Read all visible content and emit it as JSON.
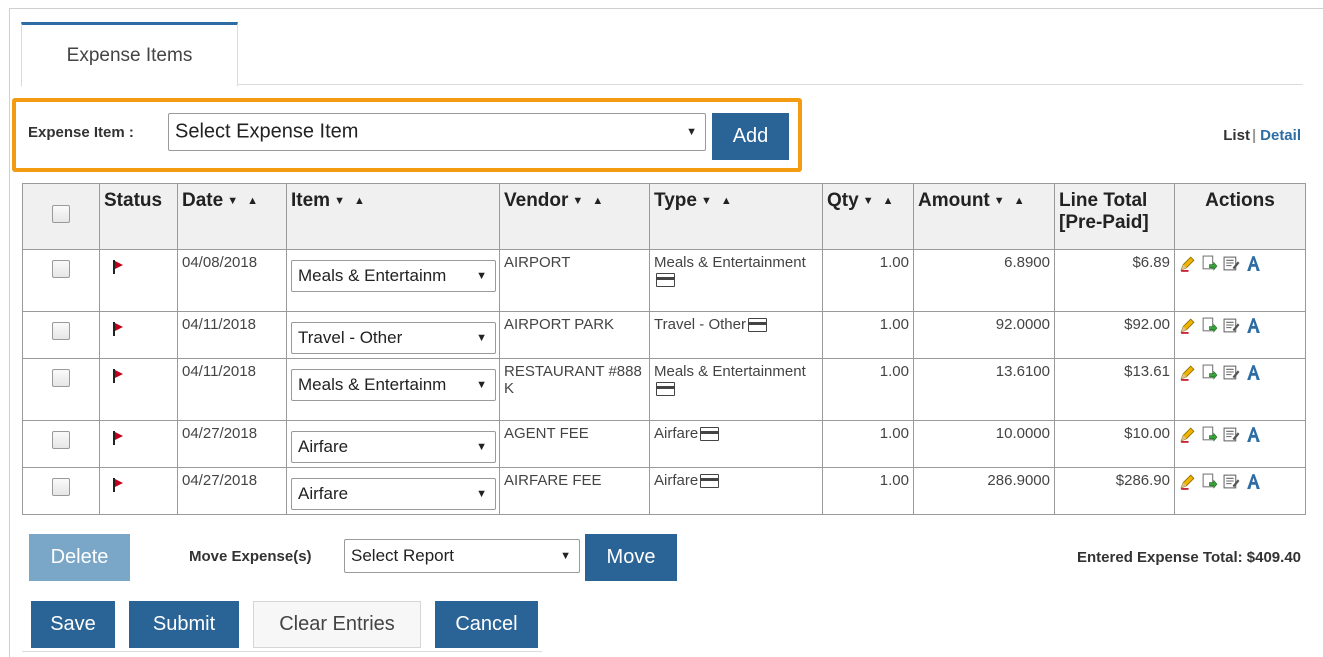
{
  "tabs": [
    {
      "label": "Expense Items"
    }
  ],
  "add_bar": {
    "label": "Expense Item :",
    "select_value": "Select Expense Item",
    "add_label": "Add"
  },
  "view_toggle": {
    "list": "List",
    "separator": "|",
    "detail": "Detail"
  },
  "table": {
    "headers": {
      "status": "Status",
      "date": "Date",
      "item": "Item",
      "vendor": "Vendor",
      "type": "Type",
      "qty": "Qty",
      "amount": "Amount",
      "line_total": "Line Total [Pre-Paid]",
      "actions": "Actions"
    },
    "sort_glyphs": "▼ ▲",
    "rows": [
      {
        "date": "04/08/2018",
        "item": "Meals & Entertainm",
        "vendor": "AIRPORT",
        "type": "Meals & Entertainment",
        "qty": "1.00",
        "amount": "6.8900",
        "line_total": "$6.89"
      },
      {
        "date": "04/11/2018",
        "item": "Travel - Other",
        "vendor": "AIRPORT PARK",
        "type": "Travel - Other",
        "qty": "1.00",
        "amount": "92.0000",
        "line_total": "$92.00"
      },
      {
        "date": "04/11/2018",
        "item": "Meals & Entertainm",
        "vendor": "RESTAURANT #888 K",
        "type": "Meals & Entertainment",
        "qty": "1.00",
        "amount": "13.6100",
        "line_total": "$13.61"
      },
      {
        "date": "04/27/2018",
        "item": "Airfare",
        "vendor": "AGENT FEE",
        "type": "Airfare",
        "qty": "1.00",
        "amount": "10.0000",
        "line_total": "$10.00"
      },
      {
        "date": "04/27/2018",
        "item": "Airfare",
        "vendor": "AIRFARE FEE",
        "type": "Airfare",
        "qty": "1.00",
        "amount": "286.9000",
        "line_total": "$286.90"
      }
    ]
  },
  "footer": {
    "delete_label": "Delete",
    "move_label": "Move Expense(s)",
    "report_select_value": "Select Report",
    "move_button": "Move",
    "total_label": "Entered Expense Total: $409.40",
    "save": "Save",
    "submit": "Submit",
    "clear": "Clear Entries",
    "cancel": "Cancel"
  },
  "icons": {
    "status": "flag-icon",
    "payment": "credit-card-icon",
    "actions": [
      "edit-pencil-icon",
      "copy-document-icon",
      "notes-icon",
      "attachment-a-icon"
    ]
  },
  "colors": {
    "primary_button": "#2a6496",
    "delete_button_disabled": "#7aa7c7",
    "highlight_border": "#f39c12",
    "link": "#2e6da4",
    "flag": "#c0001a"
  }
}
